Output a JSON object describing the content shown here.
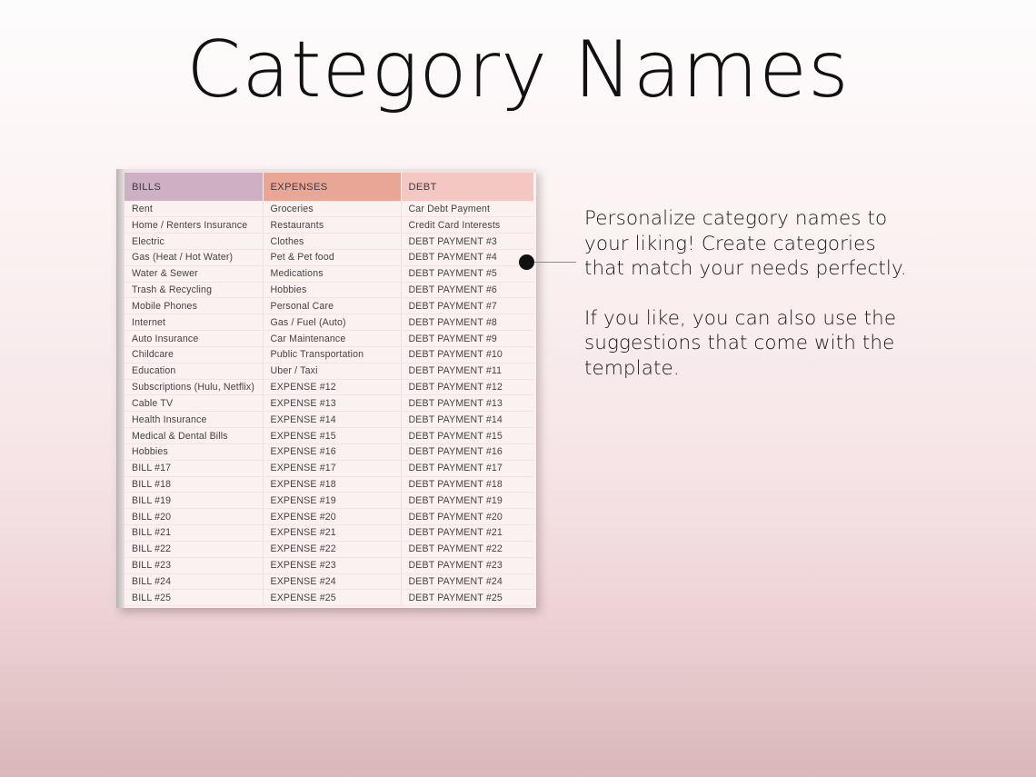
{
  "page": {
    "title": "Category Names"
  },
  "table": {
    "headers": [
      "BILLS",
      "EXPENSES",
      "DEBT"
    ],
    "header_colors": {
      "bills": "#ceb0c3",
      "expenses": "#e9a595",
      "debt": "#f4c7c3"
    },
    "rows": [
      [
        "Rent",
        "Groceries",
        "Car Debt Payment"
      ],
      [
        "Home / Renters Insurance",
        "Restaurants",
        "Credit Card Interests"
      ],
      [
        "Electric",
        "Clothes",
        "DEBT PAYMENT #3"
      ],
      [
        "Gas (Heat / Hot Water)",
        "Pet & Pet food",
        "DEBT PAYMENT #4"
      ],
      [
        "Water & Sewer",
        "Medications",
        "DEBT PAYMENT #5"
      ],
      [
        "Trash & Recycling",
        "Hobbies",
        "DEBT PAYMENT #6"
      ],
      [
        "Mobile Phones",
        "Personal Care",
        "DEBT PAYMENT #7"
      ],
      [
        "Internet",
        "Gas / Fuel (Auto)",
        "DEBT PAYMENT #8"
      ],
      [
        "Auto Insurance",
        "Car Maintenance",
        "DEBT PAYMENT #9"
      ],
      [
        "Childcare",
        "Public Transportation",
        "DEBT PAYMENT #10"
      ],
      [
        "Education",
        "Uber / Taxi",
        "DEBT PAYMENT #11"
      ],
      [
        "Subscriptions (Hulu, Netflix)",
        "EXPENSE #12",
        "DEBT PAYMENT #12"
      ],
      [
        "Cable TV",
        "EXPENSE #13",
        "DEBT PAYMENT #13"
      ],
      [
        "Health Insurance",
        "EXPENSE #14",
        "DEBT PAYMENT #14"
      ],
      [
        "Medical & Dental Bills",
        "EXPENSE #15",
        "DEBT PAYMENT #15"
      ],
      [
        "Hobbies",
        "EXPENSE #16",
        "DEBT PAYMENT #16"
      ],
      [
        "BILL #17",
        "EXPENSE #17",
        "DEBT PAYMENT #17"
      ],
      [
        "BILL #18",
        "EXPENSE #18",
        "DEBT PAYMENT #18"
      ],
      [
        "BILL #19",
        "EXPENSE #19",
        "DEBT PAYMENT #19"
      ],
      [
        "BILL #20",
        "EXPENSE #20",
        "DEBT PAYMENT #20"
      ],
      [
        "BILL #21",
        "EXPENSE #21",
        "DEBT PAYMENT #21"
      ],
      [
        "BILL #22",
        "EXPENSE #22",
        "DEBT PAYMENT #22"
      ],
      [
        "BILL #23",
        "EXPENSE #23",
        "DEBT PAYMENT #23"
      ],
      [
        "BILL #24",
        "EXPENSE #24",
        "DEBT PAYMENT #24"
      ],
      [
        "BILL #25",
        "EXPENSE #25",
        "DEBT PAYMENT #25"
      ]
    ]
  },
  "annotation": {
    "paragraphs": [
      "Personalize category names to your liking! Create categories that match your needs perfectly.",
      "If you like, you can also use the suggestions that come with the template."
    ]
  }
}
